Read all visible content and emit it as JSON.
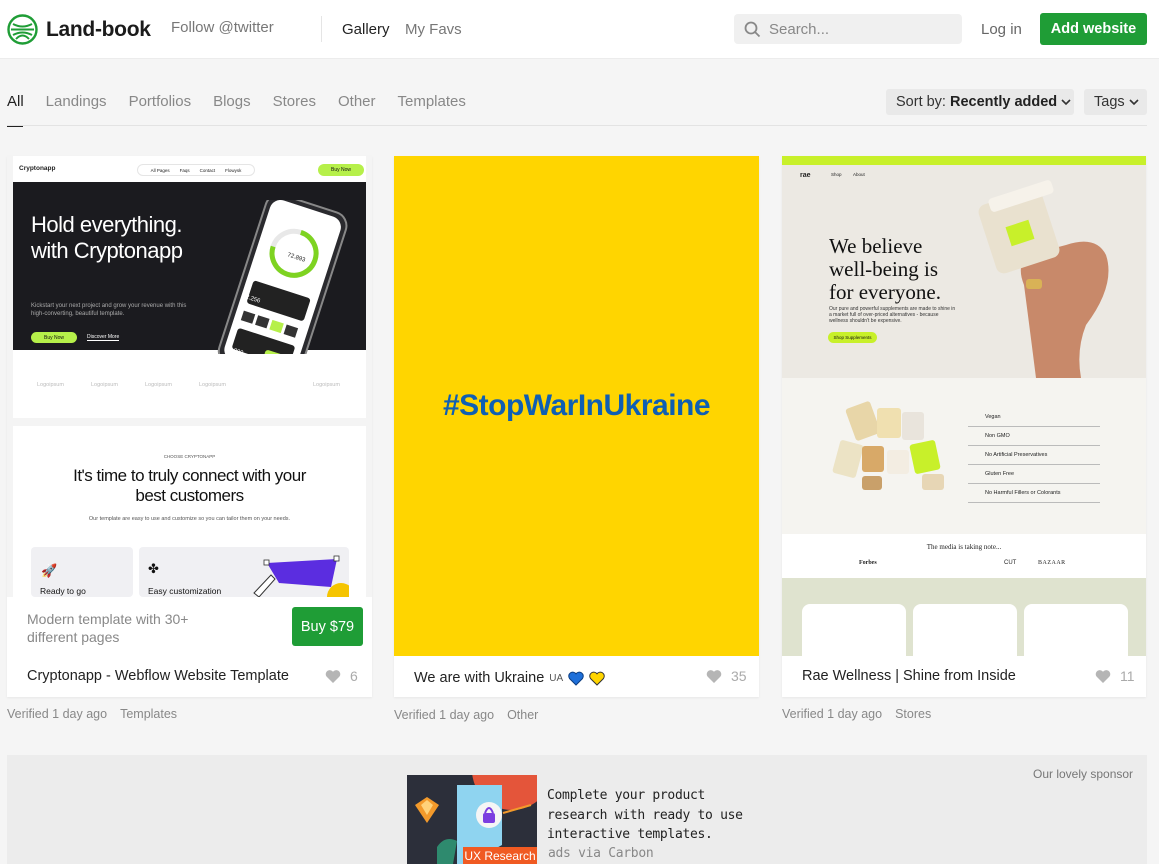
{
  "header": {
    "logo_text": "Land-book",
    "follow": "Follow @twitter",
    "nav": {
      "gallery": "Gallery",
      "favs": "My Favs"
    },
    "search_placeholder": "Search...",
    "login": "Log in",
    "add_website": "Add website",
    "accent_color": "#1f9d36"
  },
  "filters": {
    "items": [
      "All",
      "Landings",
      "Portfolios",
      "Blogs",
      "Stores",
      "Other",
      "Templates"
    ],
    "active": "All",
    "sort_prefix": "Sort by:",
    "sort_value": "Recently added",
    "tags": "Tags"
  },
  "cards": [
    {
      "title": "Cryptonapp - Webflow Website Template",
      "likes": "6",
      "meta_verified": "Verified 1 day ago",
      "meta_category": "Templates",
      "overlay_desc": "Modern template with 30+ different pages",
      "buy_label": "Buy $79",
      "preview": {
        "brand": "Cryptonapp",
        "nav": [
          "All Pages",
          "Faqs",
          "Contact",
          "Flowysk"
        ],
        "nav_button": "Buy Now",
        "headline_1": "Hold everything.",
        "headline_2": "with Cryptonapp",
        "subtext": "Kickstart your next project and grow your revenue with this high-converting, beautiful template.",
        "btn_primary": "Buy Now",
        "btn_secondary": "Discover More",
        "logo_item": "Logoipsum",
        "section_kicker": "CHOOSE CRYPTONAPP",
        "section_title_1": "It's time to truly connect with your",
        "section_title_2": "best customers",
        "section_sub": "Our template are easy to use and customize so you can tailor them on your needs.",
        "box_1": "Ready to go",
        "box_2": "Easy customization",
        "phone_balance": "72.893",
        "phone_value": "22.256",
        "phone_value_2": "41.000"
      }
    },
    {
      "title": "We are with Ukraine",
      "title_badge": "UA",
      "likes": "35",
      "meta_verified": "Verified 1 day ago",
      "meta_category": "Other",
      "preview": {
        "text": "#StopWarInUkraine",
        "bg": "#ffd500",
        "fg": "#0f5fb3"
      }
    },
    {
      "title": "Rae Wellness | Shine from Inside",
      "likes": "11",
      "meta_verified": "Verified 1 day ago",
      "meta_category": "Stores",
      "preview": {
        "brand": "rae",
        "nav": [
          "Shop",
          "About"
        ],
        "headline_1": "We believe",
        "headline_2": "well-being is",
        "headline_3": "for everyone.",
        "subtext": "Our pure and powerful supplements are made to shine in a market full of over-priced alternatives - because wellness shouldn't be expensive.",
        "cta": "Shop Supplements",
        "features": [
          "Vegan",
          "Non GMO",
          "No Artificial Preservatives",
          "Gluten Free",
          "No Harmful Fillers or Colorants"
        ],
        "media_title": "The media is taking note...",
        "media_logos": [
          "Forbes",
          "CUT",
          "BAZAAR"
        ]
      }
    }
  ],
  "sponsor": {
    "label": "Our lovely sponsor",
    "ad_text": "Complete your product research with ready to use interactive templates.",
    "ad_tag": "UX Research",
    "via": "ads via Carbon"
  }
}
